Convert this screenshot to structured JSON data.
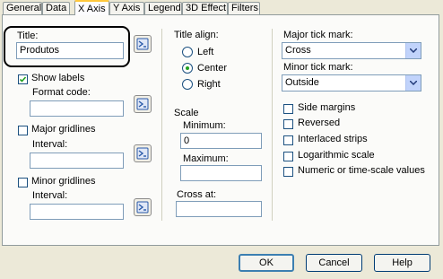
{
  "tabs": [
    {
      "label": "General"
    },
    {
      "label": "Data"
    },
    {
      "label": "X Axis"
    },
    {
      "label": "Y Axis"
    },
    {
      "label": "Legend"
    },
    {
      "label": "3D Effect"
    },
    {
      "label": "Filters"
    }
  ],
  "active_tab": "X Axis",
  "title": {
    "label": "Title:",
    "value": "Produtos"
  },
  "show_labels": {
    "label": "Show labels",
    "checked": true
  },
  "format_code": {
    "label": "Format code:",
    "value": ""
  },
  "major_gridlines": {
    "label": "Major gridlines",
    "checked": false
  },
  "major_interval": {
    "label": "Interval:",
    "value": ""
  },
  "minor_gridlines": {
    "label": "Minor gridlines",
    "checked": false
  },
  "minor_interval": {
    "label": "Interval:",
    "value": ""
  },
  "title_align": {
    "label": "Title align:",
    "options": [
      "Left",
      "Center",
      "Right"
    ],
    "selected": "Center"
  },
  "scale": {
    "label": "Scale",
    "minimum_label": "Minimum:",
    "minimum_value": "0",
    "maximum_label": "Maximum:",
    "maximum_value": ""
  },
  "cross_at": {
    "label": "Cross at:",
    "value": ""
  },
  "major_tick": {
    "label": "Major tick mark:",
    "value": "Cross"
  },
  "minor_tick": {
    "label": "Minor tick mark:",
    "value": "Outside"
  },
  "options": [
    {
      "label": "Side margins",
      "checked": false
    },
    {
      "label": "Reversed",
      "checked": false
    },
    {
      "label": "Interlaced strips",
      "checked": false
    },
    {
      "label": "Logarithmic scale",
      "checked": false
    },
    {
      "label": "Numeric or time-scale values",
      "checked": false
    }
  ],
  "buttons": {
    "ok": "OK",
    "cancel": "Cancel",
    "help": "Help"
  },
  "colors": {
    "face": "#ece9d8",
    "accent": "#3c7fb1",
    "tab_highlight": "#ffc83c"
  },
  "icons": {
    "expression_button": "expression-builder-icon",
    "dropdown": "chevron-down-icon",
    "check": "checkmark-icon"
  }
}
